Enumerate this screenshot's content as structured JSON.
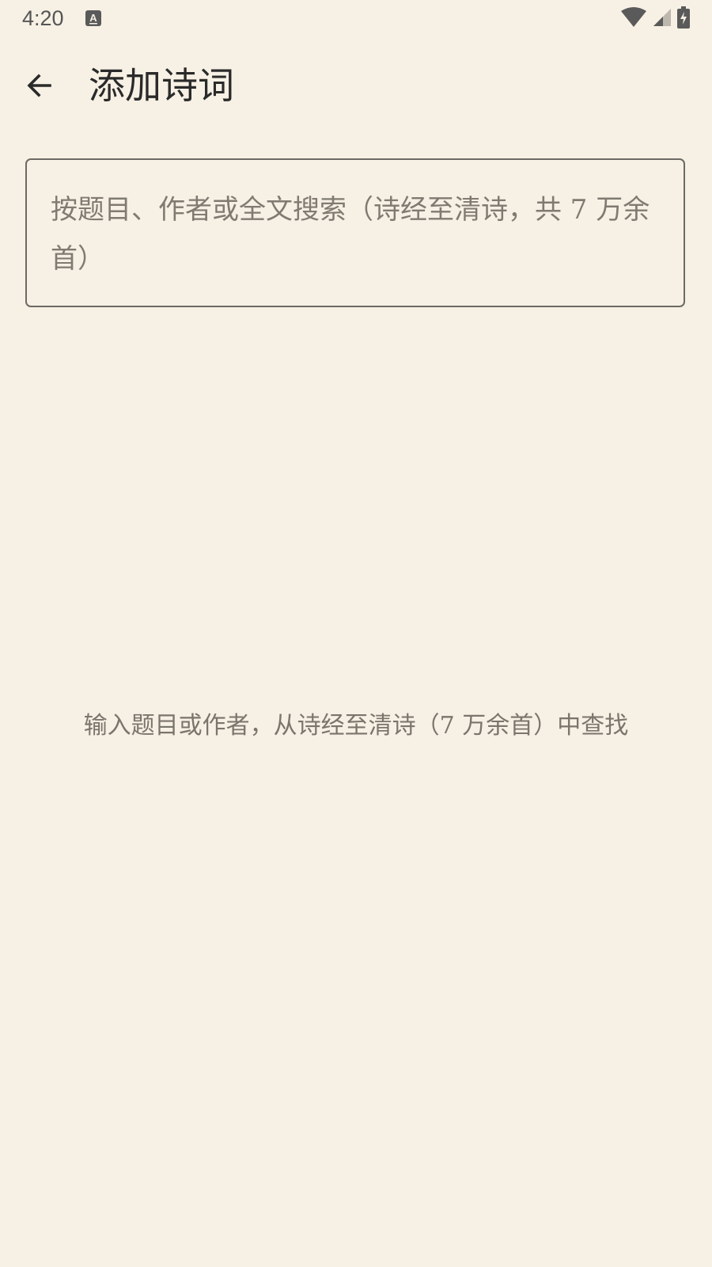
{
  "status_bar": {
    "time": "4:20",
    "notification_icon": "a-font-icon",
    "icons": [
      "wifi-icon",
      "cellular-signal-icon",
      "battery-charging-icon"
    ],
    "icon_color": "#5a5a5a"
  },
  "app_bar": {
    "back_icon": "arrow-left-icon",
    "title": "添加诗词"
  },
  "search": {
    "value": "",
    "placeholder": "按题目、作者或全文搜索（诗经至清诗，共 7 万余首）"
  },
  "empty_state": {
    "hint": "输入题目或作者，从诗经至清诗（7 万余首）中查找"
  },
  "colors": {
    "background": "#f7f0e4",
    "text_primary": "#2a2a2a",
    "text_secondary": "#7a756d",
    "outline": "#6c6a64"
  }
}
